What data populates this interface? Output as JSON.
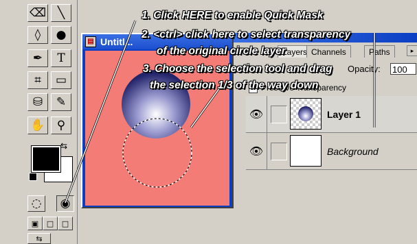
{
  "document": {
    "title": "Untitl...",
    "controls": [
      "_",
      "□",
      "×"
    ]
  },
  "layers_panel": {
    "tabs": [
      "Layers",
      "Channels",
      "Paths"
    ],
    "opacity_label": "Opacity:",
    "opacity_value": "100",
    "preserve_transparency_label": "Preserve Transparency",
    "layers": [
      {
        "name": "Layer 1",
        "visible": true,
        "selected": true
      },
      {
        "name": "Background",
        "visible": true,
        "selected": false
      }
    ]
  },
  "toolbox": {
    "tools": [
      "eraser-icon",
      "line-icon",
      "blur-icon",
      "burn-icon",
      "pen-icon",
      "type-icon",
      "measure-icon",
      "gradient-icon",
      "paint-bucket-icon",
      "eyedropper-icon",
      "hand-icon",
      "zoom-icon"
    ],
    "mask_modes": [
      "standard-mode-icon",
      "quick-mask-mode-icon"
    ]
  },
  "annotations": {
    "step1": "1. Click HERE to enable Quick Mask",
    "step2_line1": "2. <ctrl> click here to select transparency",
    "step2_line2": "of the original circle layer",
    "step3_line1": "3. Choose the selection tool and drag",
    "step3_line2": "the selection 1/3 of the way down"
  },
  "colors": {
    "canvas": "#f37d76",
    "window_title": "#1b4fcf",
    "annotation_text": "#ffffff"
  }
}
